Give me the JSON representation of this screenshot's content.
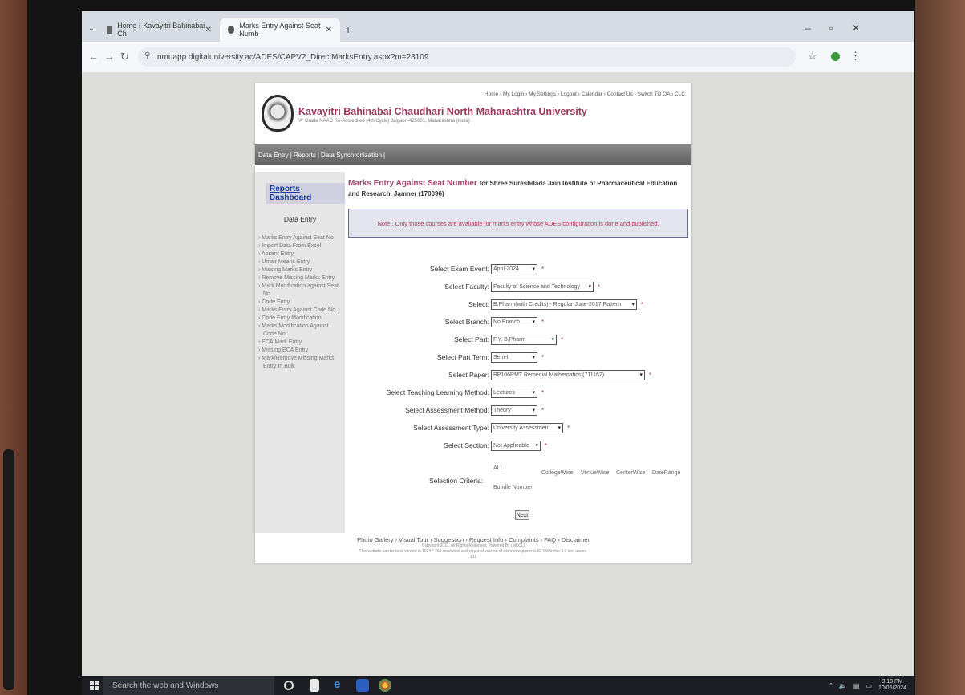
{
  "browser": {
    "tabs": [
      {
        "label": "Home › Kavayitri Bahinabai Ch"
      },
      {
        "label": "Marks Entry Against Seat Numb"
      }
    ],
    "url": "nmuapp.digitaluniversity.ac/ADES/CAPV2_DirectMarksEntry.aspx?m=28109"
  },
  "header": {
    "top_links": "Home  › My Login  › My Settings  › Logout  › Calendar  › Contact Us  › Switch TO OA  › CLC",
    "university": "Kavayitri Bahinabai Chaudhari North Maharashtra University",
    "subtitle": "'A' Grade NAAC Re-Accredited (4th Cycle) Jalgaon-425001, Maharashtra (India)"
  },
  "menu": [
    "Data Entry",
    "Reports",
    "Data Synchronization"
  ],
  "sidebar": {
    "title": "Reports Dashboard",
    "heading": "Data Entry",
    "items": [
      "Marks Entry Against Seat No",
      "Import Data From Excel",
      "Absent Entry",
      "Unfair Means Entry",
      "Missing Marks Entry",
      "Remove Missing Marks Entry",
      "Mark Modification against Seat No",
      "Code Entry",
      "Marks Entry Against Code No",
      "Code Entry Modification",
      "Marks Modification Against Code No",
      "ECA Mark Entry",
      "Missing ECA Entry",
      "Mark/Remove Missing Marks Entry In Bulk"
    ]
  },
  "content": {
    "title": "Marks Entry Against Seat Number",
    "institute": "for Shree Sureshdada Jain Institute of Pharmaceutical Education and Research, Jamner (170096)",
    "note": "Note : Only those courses are available for marks entry whose ADES configuration is done and published."
  },
  "form": {
    "fields": [
      {
        "label": "Select Exam Event:",
        "value": "April-2024"
      },
      {
        "label": "Select Faculty:",
        "value": "Faculty of Science and Technology"
      },
      {
        "label": "Select:",
        "value": "B.Pharm(with Credits) - Regular-June-2017 Pattern"
      },
      {
        "label": "Select Branch:",
        "value": "No Branch"
      },
      {
        "label": "Select Part:",
        "value": "F.Y. B.Pharm"
      },
      {
        "label": "Select Part Term:",
        "value": "Sem-I"
      },
      {
        "label": "Select Paper:",
        "value": "BP106RMT Remedial Mathematics (711162)"
      },
      {
        "label": "Select Teaching Learning Method:",
        "value": "Lectures"
      },
      {
        "label": "Select Assessment Method:",
        "value": "Theory"
      },
      {
        "label": "Select Assessment Type:",
        "value": "University Assessment"
      },
      {
        "label": "Select Section:",
        "value": "Not Applicable"
      }
    ],
    "required_mark": "*",
    "criteria_label": "Selection Criteria:",
    "criteria_options": [
      "ALL",
      "CollegeWise",
      "VenueWise",
      "CenterWise",
      "DateRange",
      "Bundle Number"
    ],
    "next_label": "Next"
  },
  "footer": {
    "links": "Photo Gallery  › Visual Tour  › Suggestion  › Request Info  › Complaints  › FAQ  › Disclaimer",
    "copyright": "Copyright 2011. All Rights Reserved. Powered By (MKCL)",
    "compat": "This website can be best viewed in 1024 * 768 resolution and required version of internet explorer is IE 7.0/firefox 3.0 and above.",
    "number": "131"
  },
  "taskbar": {
    "search_placeholder": "Search the web and Windows",
    "time": "3:13 PM",
    "date": "10/06/2024"
  }
}
